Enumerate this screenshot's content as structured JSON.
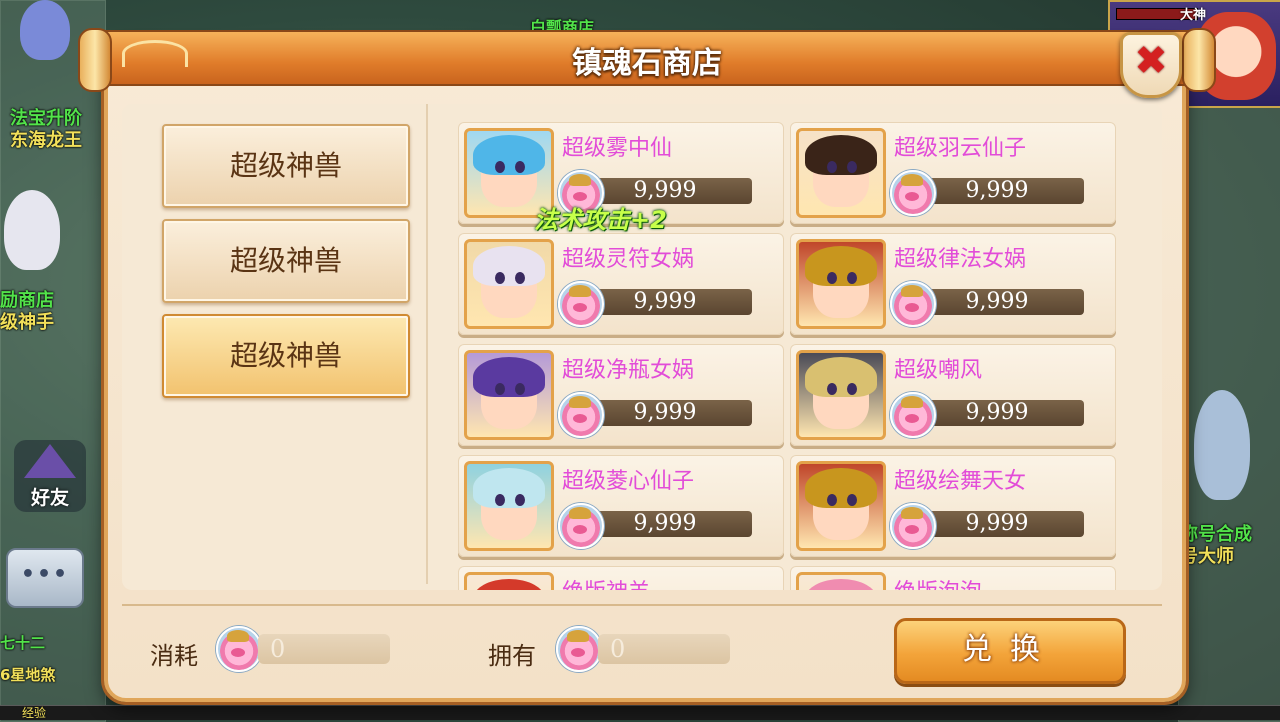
{
  "background": {
    "left_texts": [
      "法宝升阶",
      "东海龙王",
      "励商店",
      "级神手",
      "七十二",
      "6星地煞"
    ],
    "right_texts": [
      "称号合成",
      "号大师"
    ],
    "top_text": "白瓢商店",
    "friend_label": "好友",
    "chat_dots": "•••",
    "portrait_name": "大神",
    "exp_label": "经验"
  },
  "dialog": {
    "title": "镇魂石商店",
    "close_symbol": "✖"
  },
  "categories": [
    {
      "label": "超级神兽",
      "active": false
    },
    {
      "label": "超级神兽",
      "active": false
    },
    {
      "label": "超级神兽",
      "active": true
    }
  ],
  "items": [
    {
      "name": "超级雾中仙",
      "price": "9,999",
      "hair": "#4fb6e8",
      "bg": "#9fd8f2"
    },
    {
      "name": "超级羽云仙子",
      "price": "9,999",
      "hair": "#3a2418",
      "bg": "#f6e2c8"
    },
    {
      "name": "超级灵符女娲",
      "price": "9,999",
      "hair": "#e8e2f0",
      "bg": "#f1d9a8"
    },
    {
      "name": "超级律法女娲",
      "price": "9,999",
      "hair": "#c8961e",
      "bg": "#c0462a"
    },
    {
      "name": "超级净瓶女娲",
      "price": "9,999",
      "hair": "#5a3aa0",
      "bg": "#b49ad8"
    },
    {
      "name": "超级嘲风",
      "price": "9,999",
      "hair": "#d9c070",
      "bg": "#4a4a56"
    },
    {
      "name": "超级菱心仙子",
      "price": "9,999",
      "hair": "#bfe6ef",
      "bg": "#8fd2e0"
    },
    {
      "name": "超级绘舞天女",
      "price": "9,999",
      "hair": "#c8961e",
      "bg": "#c0462a"
    },
    {
      "name": "绝版神羊",
      "price": "",
      "hair": "#d43a2a",
      "bg": "#f7e8d6"
    },
    {
      "name": "绝版泡泡",
      "price": "",
      "hair": "#f08cb0",
      "bg": "#f7e8d6"
    }
  ],
  "floating_bonus": "法术攻击+2",
  "footer": {
    "cost_label": "消耗",
    "cost_value": "0",
    "own_label": "拥有",
    "own_value": "0",
    "exchange_label": "兑换"
  },
  "colors": {
    "item_name": "#e24cd8",
    "title_bar": "#e07c2a",
    "close_x": "#d42020",
    "bonus_text": "#c7ff4a"
  }
}
